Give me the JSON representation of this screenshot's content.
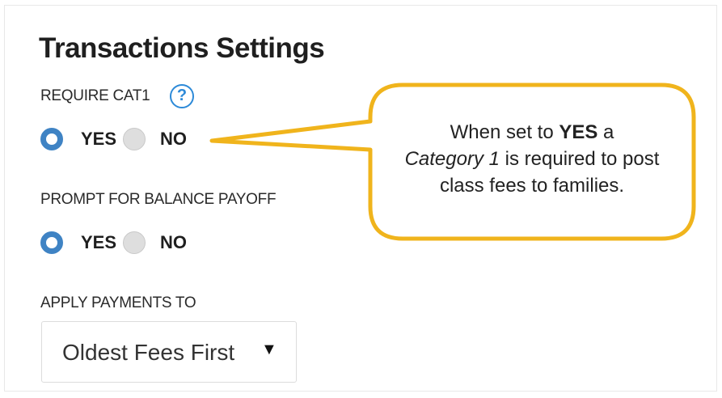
{
  "settings": {
    "title": "Transactions Settings",
    "require_cat1": {
      "label": "REQUIRE CAT1",
      "help_icon": "?",
      "yes_label": "YES",
      "no_label": "NO",
      "selected": "YES"
    },
    "prompt_balance_payoff": {
      "label": "PROMPT FOR BALANCE PAYOFF",
      "yes_label": "YES",
      "no_label": "NO",
      "selected": "YES"
    },
    "apply_payments": {
      "label": "APPLY PAYMENTS TO",
      "selected_value": "Oldest Fees First",
      "caret": "▼"
    }
  },
  "callout": {
    "text_pre": "When set to ",
    "text_bold": "YES",
    "text_mid": " a",
    "text_italic": "Category 1",
    "text_post": " is required to post class fees to families."
  },
  "colors": {
    "radio_selected": "#3f83c4",
    "help_icon": "#2d8ad8",
    "callout_border": "#f0b41c"
  }
}
